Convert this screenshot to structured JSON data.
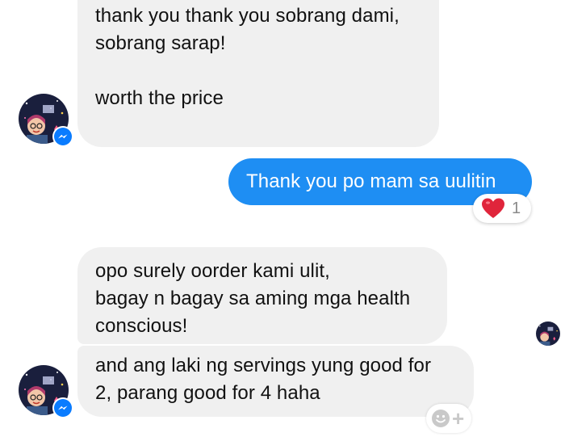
{
  "thread": {
    "messages": [
      {
        "sender": "contact",
        "lines": [
          "thank you thank you sobrang dami,",
          "sobrang sarap!",
          "",
          "worth the price"
        ]
      },
      {
        "sender": "me",
        "lines": [
          "Thank you po mam sa uulitin"
        ],
        "reaction": {
          "icon": "heart-icon",
          "count": "1"
        }
      },
      {
        "sender": "contact",
        "lines": [
          "opo surely oorder kami ulit,",
          "bagay n bagay sa aming mga health",
          "conscious!"
        ]
      },
      {
        "sender": "contact",
        "lines": [
          "and ang laki ng servings yung good for",
          "2, parang good for 4 haha"
        ]
      }
    ]
  },
  "colors": {
    "outgoing_bubble": "#1e8ef3",
    "incoming_bubble": "#f0f0f0",
    "messenger_badge": "#0a7cff",
    "heart": "#e0253b"
  },
  "icons": {
    "contact_avatar": "avatar",
    "messenger_badge": "messenger-icon",
    "reaction": "heart-icon",
    "add_reaction": "smiley-plus-icon"
  }
}
